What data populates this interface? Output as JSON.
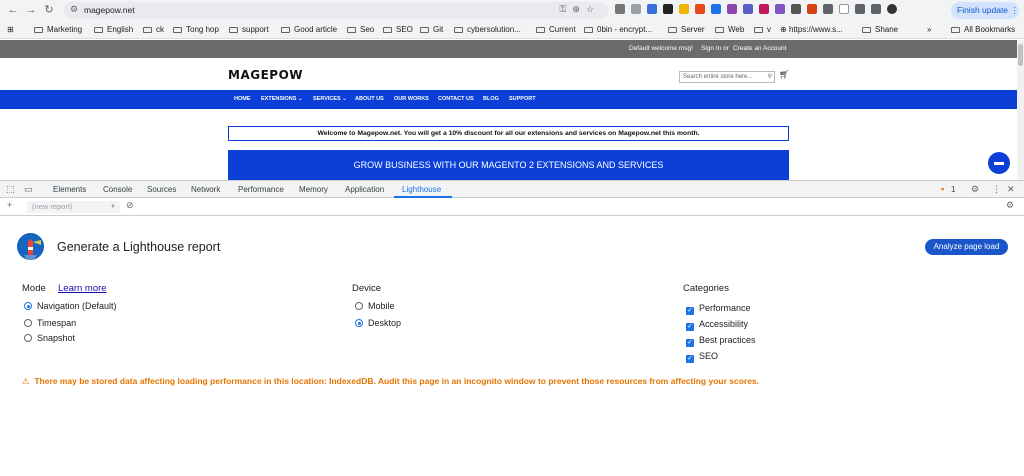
{
  "browser": {
    "url": "magepow.net",
    "finish_update": "Finish update",
    "bookmarks": [
      "Marketing",
      "English",
      "ck",
      "Tong hop",
      "support",
      "Good article",
      "Seo",
      "SEO",
      "Git",
      "cybersolution...",
      "Current",
      "0bin - encrypt...",
      "Server",
      "Web",
      "v",
      "https://www.s...",
      "Shane"
    ],
    "all_bookmarks": "All Bookmarks",
    "more_bookmarks": "»"
  },
  "site": {
    "welcome": "Default welcome msg!",
    "sign_in": "Sign In",
    "or": "or",
    "create_account": "Create an Account",
    "logo": "MAGEPOW",
    "search_placeholder": "Search entire store here...",
    "nav": [
      "HOME",
      "EXTENSIONS",
      "SERVICES",
      "ABOUT US",
      "OUR WORKS",
      "CONTACT US",
      "BLOG",
      "SUPPORT"
    ],
    "promo": "Welcome to Magepow.net. You will get a 10% discount for all our extensions and services on Magepow.net this month.",
    "banner": "GROW BUSINESS WITH OUR MAGENTO 2 EXTENSIONS AND SERVICES"
  },
  "devtools": {
    "tabs": [
      "Elements",
      "Console",
      "Sources",
      "Network",
      "Performance",
      "Memory",
      "Application",
      "Lighthouse"
    ],
    "active_tab": "Lighthouse",
    "issues_count": "1",
    "report_select": "(new report)",
    "plus": "+"
  },
  "lighthouse": {
    "title": "Generate a Lighthouse report",
    "analyze": "Analyze page load",
    "mode_label": "Mode",
    "learn_more": "Learn more",
    "modes": [
      "Navigation (Default)",
      "Timespan",
      "Snapshot"
    ],
    "mode_selected": "Navigation (Default)",
    "device_label": "Device",
    "devices": [
      "Mobile",
      "Desktop"
    ],
    "device_selected": "Desktop",
    "categories_label": "Categories",
    "categories": [
      "Performance",
      "Accessibility",
      "Best practices",
      "SEO"
    ],
    "warning": "There may be stored data affecting loading performance in this location: IndexedDB. Audit this page in an incognito window to prevent those resources from affecting your scores."
  }
}
